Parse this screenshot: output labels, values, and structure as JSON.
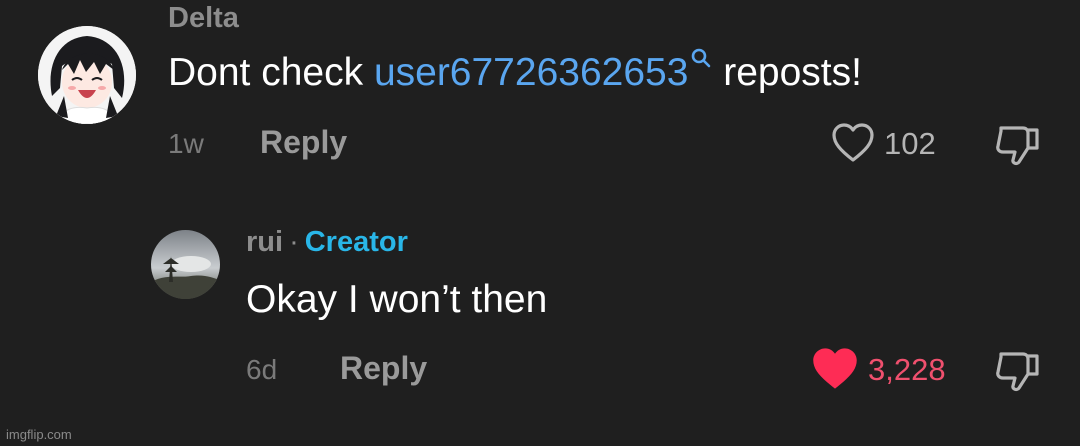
{
  "comments": [
    {
      "username": "Delta",
      "body_prefix": "Dont check ",
      "mention": "user67726362653",
      "body_suffix": " reposts!",
      "age": "1w",
      "reply_label": "Reply",
      "likes": "102",
      "liked": false
    },
    {
      "username": "rui",
      "separator": "·",
      "badge": "Creator",
      "body": "Okay I won’t then",
      "age": "6d",
      "reply_label": "Reply",
      "likes": "3,228",
      "liked": true
    }
  ],
  "colors": {
    "background": "#1f1f1f",
    "mention": "#5aa6f0",
    "creator_badge": "#29b6e8",
    "liked_heart": "#fe2c55"
  },
  "icons": [
    "search-icon",
    "heart-outline-icon",
    "heart-filled-icon",
    "thumbs-down-icon"
  ],
  "watermark": "imgflip.com"
}
